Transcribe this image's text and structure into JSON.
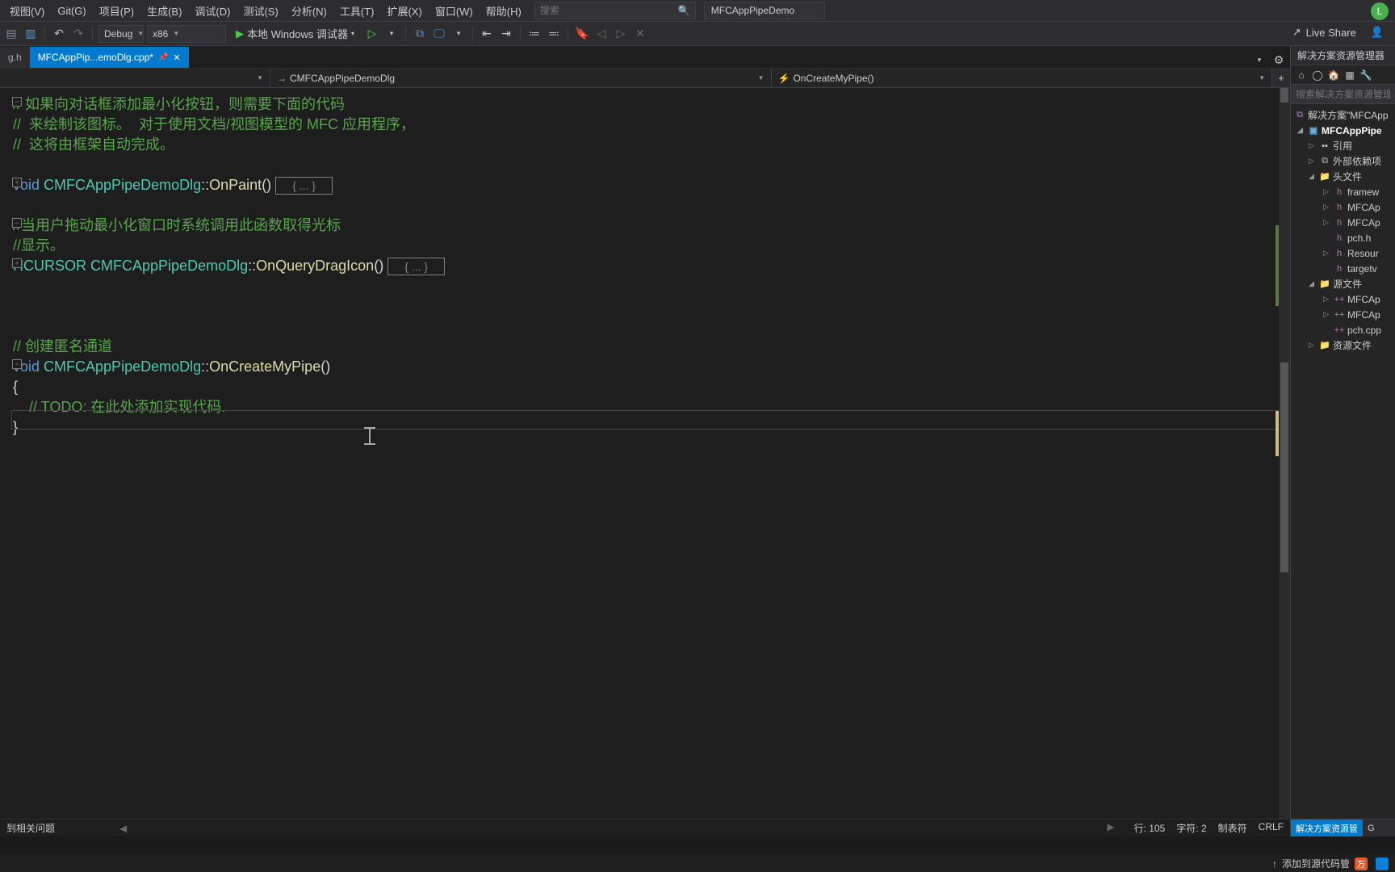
{
  "menu": {
    "items": [
      "视图(V)",
      "Git(G)",
      "项目(P)",
      "生成(B)",
      "调试(D)",
      "测试(S)",
      "分析(N)",
      "工具(T)",
      "扩展(X)",
      "窗口(W)",
      "帮助(H)"
    ],
    "search_placeholder": "搜索",
    "project_name": "MFCAppPipeDemo",
    "user_initial": "L"
  },
  "toolbar": {
    "config": "Debug",
    "platform": "x86",
    "run_label": "本地 Windows 调试器"
  },
  "liveshare": {
    "label": "Live Share"
  },
  "tabs": {
    "inactive": "g.h",
    "active": "MFCAppPip...emoDlg.cpp*"
  },
  "nav": {
    "scope": "",
    "class_icon": "→",
    "class": "CMFCAppPipeDemoDlg",
    "member_icon": "⚡",
    "member": "OnCreateMyPipe()"
  },
  "code": {
    "c1": "// 如果向对话框添加最小化按钮，则需要下面的代码",
    "c2": "//  来绘制该图标。  对于使用文档/视图模型的 MFC 应用程序，",
    "c3": "//  这将由框架自动完成。",
    "kw_void": "void",
    "cls": "CMFCAppPipeDemoDlg",
    "fn_paint": "OnPaint",
    "ellipsis": "{ ... }",
    "c4": "//当用户拖动最小化窗口时系统调用此函数取得光标",
    "c5": "//显示。",
    "ret_hcursor": "HCURSOR",
    "fn_drag": "OnQueryDragIcon",
    "c6": "// 创建匿名通道",
    "fn_create": "OnCreateMyPipe",
    "brace_open": "{",
    "todo": "    // TODO: 在此处添加实现代码.",
    "brace_close": "}"
  },
  "editor_status": {
    "issues": "到相关问题",
    "line": "行: 105",
    "chars": "字符: 2",
    "tabs": "制表符",
    "crlf": "CRLF"
  },
  "solution": {
    "title": "解决方案资源管理器",
    "search_placeholder": "搜索解决方案资源管理器",
    "root": "解决方案\"MFCApp",
    "project": "MFCAppPipe",
    "refs": "引用",
    "ext_deps": "外部依赖项",
    "headers": "头文件",
    "h_files": [
      "framew",
      "MFCAp",
      "MFCAp",
      "pch.h",
      "Resour",
      "targetv"
    ],
    "sources": "源文件",
    "cpp_files": [
      "MFCAp",
      "MFCAp",
      "pch.cpp"
    ],
    "resources": "资源文件",
    "bottom_tab": "解决方案资源管",
    "bottom_tab2": "G"
  },
  "bottom": {
    "add_source": "添加到源代码管"
  }
}
